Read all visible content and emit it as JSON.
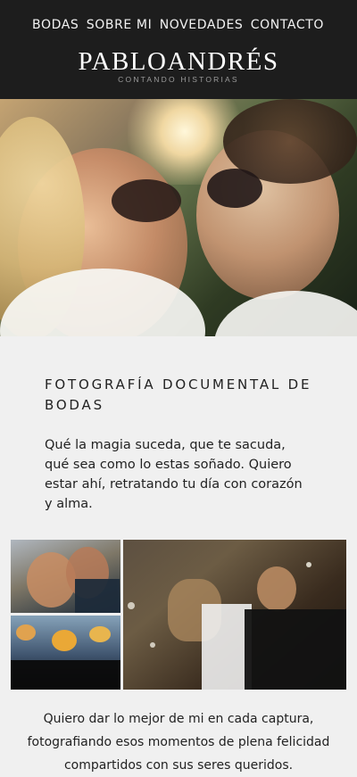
{
  "nav": {
    "items": [
      "BODAS",
      "SOBRE MI",
      "NOVEDADES",
      "CONTACTO"
    ]
  },
  "logo": {
    "title": "PABLOANDRÉS",
    "subtitle": "CONTANDO HISTORIAS"
  },
  "intro": {
    "heading": "FOTOGRAFÍA DOCUMENTAL DE BODAS",
    "text": "Qué la magia suceda, que te sacuda, qué sea como lo estas soñado. Quiero estar ahí, retratando tu día con corazón y alma."
  },
  "caption": "Quiero dar lo mejor de mi en cada captura, fotografiando esos momentos de plena felicidad compartidos con sus seres queridos."
}
